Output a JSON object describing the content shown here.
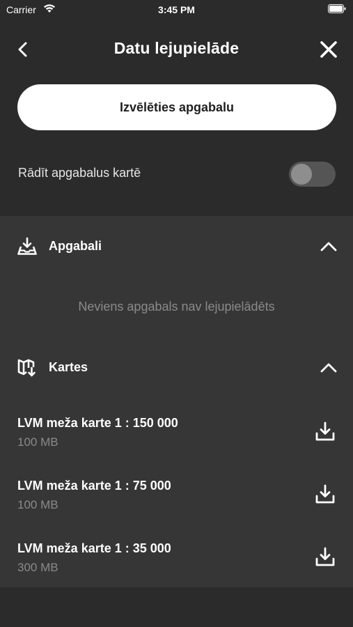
{
  "status_bar": {
    "carrier": "Carrier",
    "time": "3:45 PM"
  },
  "header": {
    "title": "Datu lejupielāde"
  },
  "primary_button": {
    "label": "Izvēlēties apgabalu"
  },
  "toggle_row": {
    "label": "Rādīt apgabalus kartē",
    "enabled": false
  },
  "sections": {
    "areas": {
      "title": "Apgabali",
      "empty_text": "Neviens apgabals nav lejupielādēts",
      "expanded": true
    },
    "maps": {
      "title": "Kartes",
      "expanded": true,
      "items": [
        {
          "name": "LVM meža karte 1 : 150 000",
          "size": "100 MB"
        },
        {
          "name": "LVM meža karte 1 : 75 000",
          "size": "100 MB"
        },
        {
          "name": "LVM meža karte 1 : 35 000",
          "size": "300 MB"
        }
      ]
    }
  },
  "icons": {
    "back": "chevron-left-icon",
    "close": "close-icon",
    "areas_section": "tray-download-icon",
    "maps_section": "map-download-icon",
    "collapse": "chevron-up-icon",
    "download": "download-icon"
  },
  "colors": {
    "background": "#2b2b2b",
    "panel": "#363636",
    "text_primary": "#ffffff",
    "text_secondary": "#8a8a8a",
    "button_bg": "#ffffff",
    "toggle_off": "#555555"
  }
}
